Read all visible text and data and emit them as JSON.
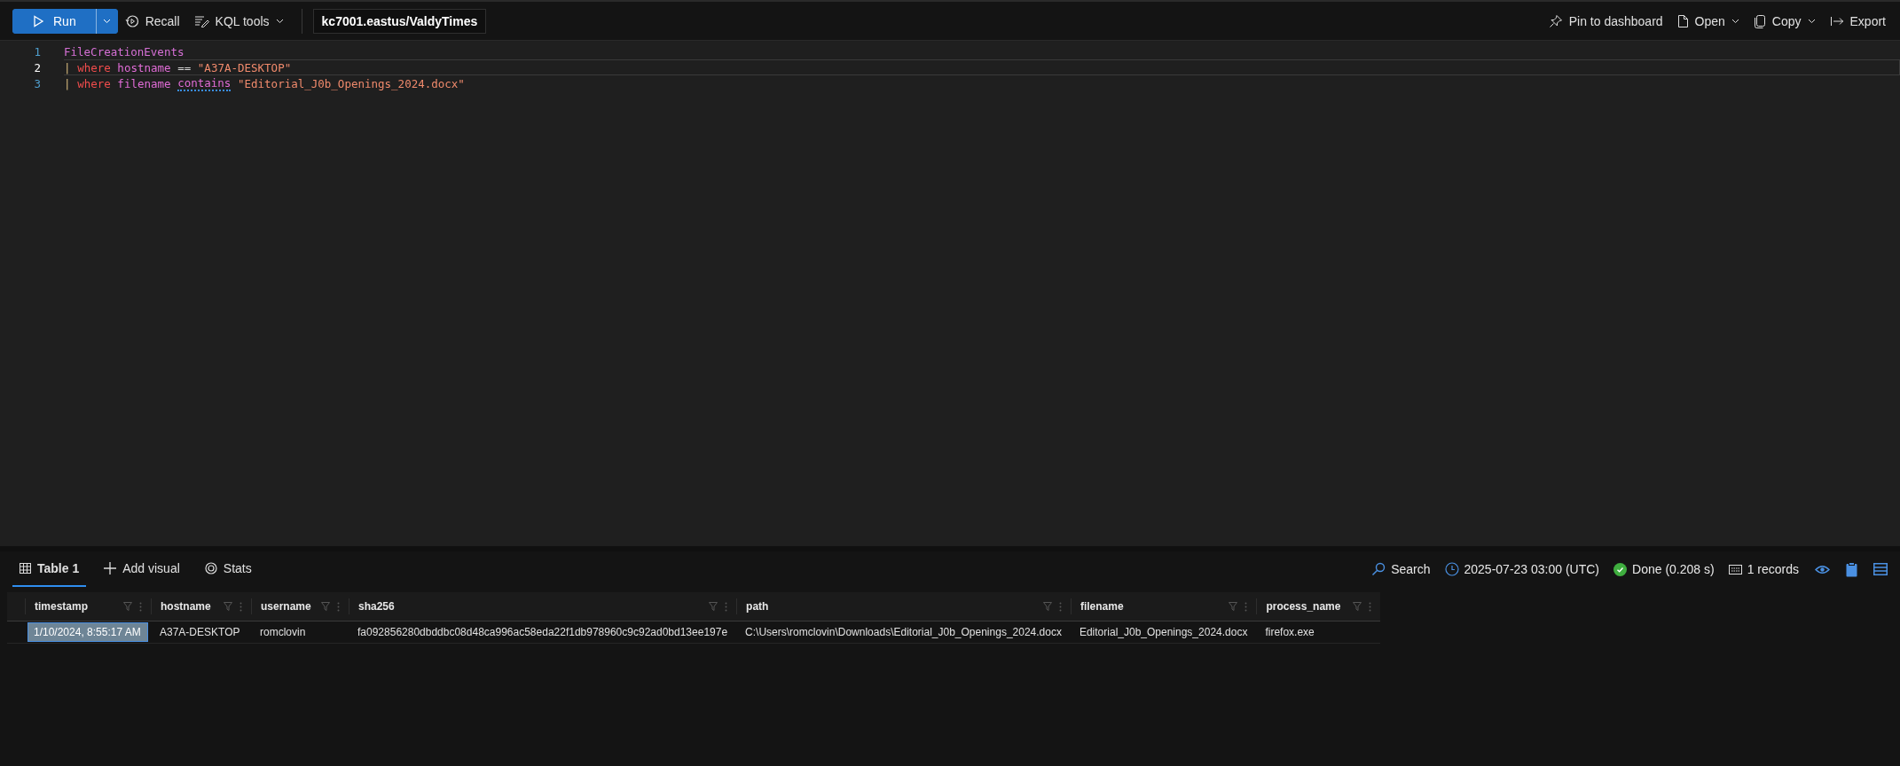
{
  "toolbar": {
    "run": {
      "label": "Run"
    },
    "actions": [
      {
        "label": "Recall",
        "has_menu": false
      },
      {
        "label": "KQL tools",
        "has_menu": true
      }
    ],
    "database": "kc7001.eastus/ValdyTimes",
    "right_actions": [
      {
        "label": "Pin to dashboard",
        "has_menu": false
      },
      {
        "label": "Open",
        "has_menu": true
      },
      {
        "label": "Copy",
        "has_menu": true
      },
      {
        "label": "Export",
        "has_menu": false
      }
    ]
  },
  "editor": {
    "lines": [
      {
        "number": "1",
        "current": false,
        "tokens": [
          {
            "text": "FileCreationEvents",
            "kind": "table"
          }
        ]
      },
      {
        "number": "2",
        "current": true,
        "tokens": [
          {
            "text": "|",
            "kind": "pipe"
          },
          {
            "text": "where",
            "kind": "keyword"
          },
          {
            "text": "hostname",
            "kind": "column"
          },
          {
            "text": "==",
            "kind": "operator"
          },
          {
            "text": "\"A37A-DESKTOP\"",
            "kind": "string"
          }
        ]
      },
      {
        "number": "3",
        "current": false,
        "tokens": [
          {
            "text": "|",
            "kind": "pipe"
          },
          {
            "text": "where",
            "kind": "keyword"
          },
          {
            "text": "filename",
            "kind": "column"
          },
          {
            "text": "contains",
            "kind": "column",
            "warning": true
          },
          {
            "text": "\"Editorial_J0b_Openings_2024.docx\"",
            "kind": "string"
          }
        ]
      }
    ]
  },
  "results": {
    "tabs": [
      {
        "label": "Table 1",
        "selected": true
      },
      {
        "label": "Add visual",
        "selected": false
      },
      {
        "label": "Stats",
        "selected": false
      }
    ],
    "search": "Search",
    "time": "2025-07-23 03:00 (UTC)",
    "status": "Done (0.208 s)",
    "records": "1 records",
    "table": {
      "columns": [
        "timestamp",
        "hostname",
        "username",
        "sha256",
        "path",
        "filename",
        "process_name"
      ],
      "rows": [
        {
          "cells": [
            {
              "text": "1/10/2024, 8:55:17 AM",
              "selected": true
            },
            {
              "text": "A37A-DESKTOP",
              "selected": false
            },
            {
              "text": "romclovin",
              "selected": false
            },
            {
              "text": "fa092856280dbddbc08d48ca996ac58eda22f1db978960c9c92ad0bd13ee197e",
              "selected": false
            },
            {
              "text": "C:\\Users\\romclovin\\Downloads\\Editorial_J0b_Openings_2024.docx",
              "selected": false
            },
            {
              "text": "Editorial_J0b_Openings_2024.docx",
              "selected": false
            },
            {
              "text": "firefox.exe",
              "selected": false
            }
          ]
        }
      ]
    }
  }
}
